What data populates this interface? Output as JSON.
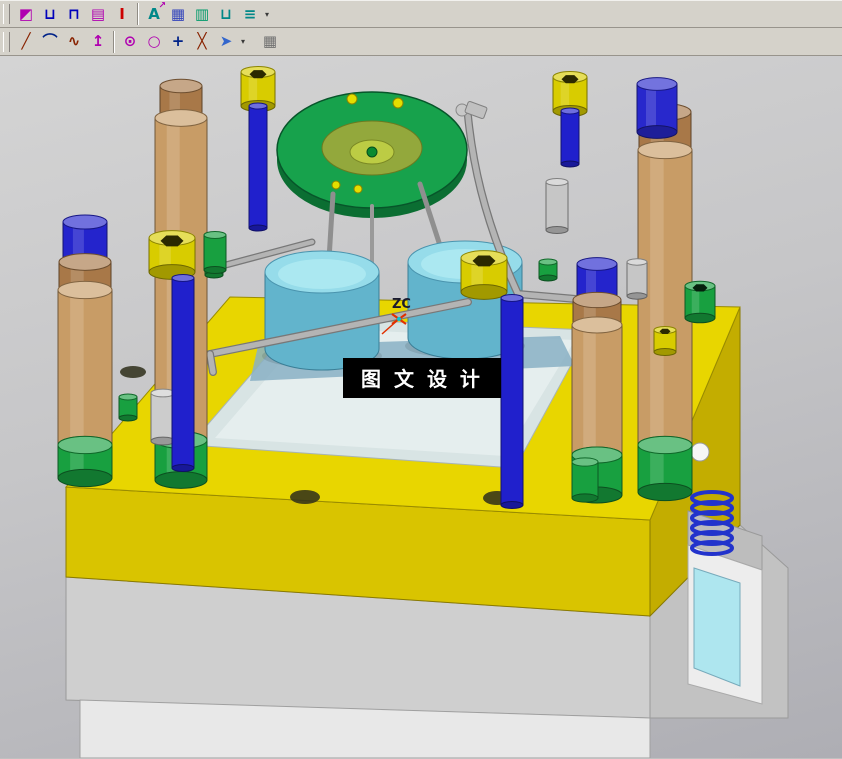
{
  "toolbars": {
    "main": {
      "items": [
        {
          "name": "sketch-icon",
          "glyph": "◩",
          "color": "#b000b0"
        },
        {
          "name": "hole-feature-icon",
          "glyph": "⊔",
          "color": "#0000bb"
        },
        {
          "name": "pocket-feature-icon",
          "glyph": "⊓",
          "color": "#0000bb"
        },
        {
          "name": "gauge-icon",
          "glyph": "▤",
          "color": "#b000b0"
        },
        {
          "name": "ibeam-icon",
          "glyph": "I",
          "color": "#cc0000"
        },
        {
          "name": "annotation-icon",
          "glyph": "A",
          "color": "#008888",
          "glyph2": "↗",
          "color2": "#b000b0",
          "sep_before": true
        },
        {
          "name": "hatch-icon",
          "glyph": "▦",
          "color": "#3344bb"
        },
        {
          "name": "histogram-icon",
          "glyph": "▥",
          "color": "#00996a"
        },
        {
          "name": "u-channel-icon",
          "glyph": "⊔",
          "color": "#008888"
        },
        {
          "name": "list-icon",
          "glyph": "≡",
          "color": "#008888",
          "dd": true
        }
      ]
    },
    "sketch": {
      "items": [
        {
          "name": "line-tool-icon",
          "glyph": "╱",
          "color": "#882200"
        },
        {
          "name": "arc-tool-icon",
          "glyph": "⌒",
          "color": "#002288"
        },
        {
          "name": "spline-tool-icon",
          "glyph": "∿",
          "color": "#882200"
        },
        {
          "name": "point-tool-icon",
          "glyph": "↥",
          "color": "#b000b0"
        },
        {
          "name": "circle-center-tool-icon",
          "glyph": "⊙",
          "color": "#b000b0",
          "sep_before": true
        },
        {
          "name": "circle-tool-icon",
          "glyph": "○",
          "color": "#b000b0"
        },
        {
          "name": "plus-tool-icon",
          "glyph": "+",
          "color": "#002288"
        },
        {
          "name": "diag-cross-tool-icon",
          "glyph": "╳",
          "color": "#882200"
        },
        {
          "name": "select-tool-icon",
          "glyph": "➤",
          "color": "#3366cc",
          "dd": true
        },
        {
          "name": "grid-calculator-icon",
          "glyph": "▦",
          "color": "#707070",
          "gap_before": true
        }
      ]
    }
  },
  "viewport": {
    "watermark": "图 文 设 计",
    "wcs_label": "ZC",
    "palette": {
      "bg_top": "#d4d4d4",
      "bg_bottom": "#aeaeb4",
      "plate_yellow": "#e8d600",
      "plate_yellow_front": "#d9c400",
      "plate_yellow_side": "#c3ad00",
      "base_gray": "#cfcfcf",
      "bottom_plate": "#e8e8e8",
      "pillar_tan": "#c89c66",
      "pillar_cap": "#a87848",
      "pin_blue": "#2020cc",
      "band_green": "#18a040",
      "ring_green": "#17a24c",
      "ring_inner": "#93a83c",
      "core_cyan": "#62b4cc",
      "core_cyan_top": "#96dcea",
      "pipe_gray": "#b4b4b4",
      "cutaway_cyan": "#aee6ef",
      "spring_blue": "#2233cc",
      "watermark_bg": "#000000",
      "watermark_text": "#ffffff"
    }
  }
}
